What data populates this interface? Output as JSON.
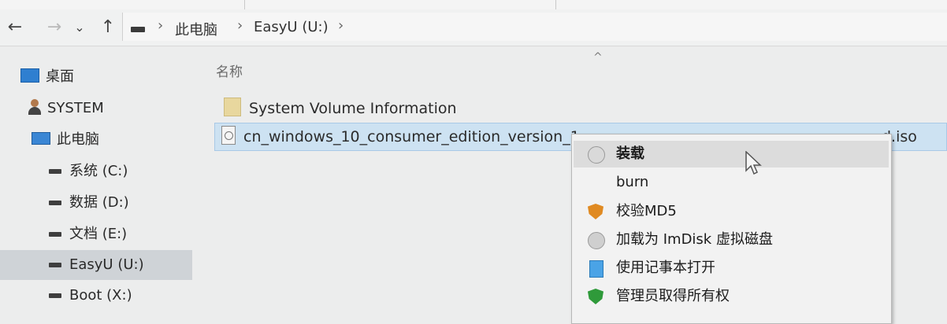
{
  "nav": {
    "back_icon": "←",
    "forward_icon": "→",
    "recent_icon": "⌄",
    "up_icon": "↑"
  },
  "address": {
    "crumbs": [
      "此电脑",
      "EasyU (U:)"
    ],
    "separator": "›"
  },
  "sidebar": {
    "items": [
      {
        "label": "桌面",
        "icon": "desktop-icon"
      },
      {
        "label": "SYSTEM",
        "icon": "user-folder-icon"
      },
      {
        "label": "此电脑",
        "icon": "this-pc-icon"
      },
      {
        "label": "系统 (C:)",
        "icon": "drive-icon"
      },
      {
        "label": "数据 (D:)",
        "icon": "drive-icon"
      },
      {
        "label": "文档 (E:)",
        "icon": "drive-icon"
      },
      {
        "label": "EasyU (U:)",
        "icon": "drive-icon",
        "selected": true
      },
      {
        "label": "Boot (X:)",
        "icon": "drive-icon"
      }
    ]
  },
  "content": {
    "column_name": "名称",
    "sort_indicator": "^",
    "files": [
      {
        "name": "System Volume Information",
        "icon": "folder-icon"
      },
      {
        "name": "cn_windows_10_consumer_edition_version_1",
        "name_tail": "d.iso",
        "icon": "disc-image-icon",
        "selected": true
      }
    ]
  },
  "context_menu": {
    "items": [
      {
        "label": "装载",
        "icon": "mount-icon",
        "bold": true,
        "hover": true
      },
      {
        "label": "burn",
        "icon": ""
      },
      {
        "label": "校验MD5",
        "icon": "shield-icon"
      },
      {
        "label": "加载为 ImDisk 虚拟磁盘",
        "icon": "disc-icon"
      },
      {
        "label": "使用记事本打开",
        "icon": "notepad-icon"
      },
      {
        "label": "管理员取得所有权",
        "icon": "shield-check-icon"
      }
    ]
  },
  "colors": {
    "selection": "#cde2f2",
    "sidebar_selected": "#cfd3d7",
    "menu_hover": "#dcdcdc"
  }
}
